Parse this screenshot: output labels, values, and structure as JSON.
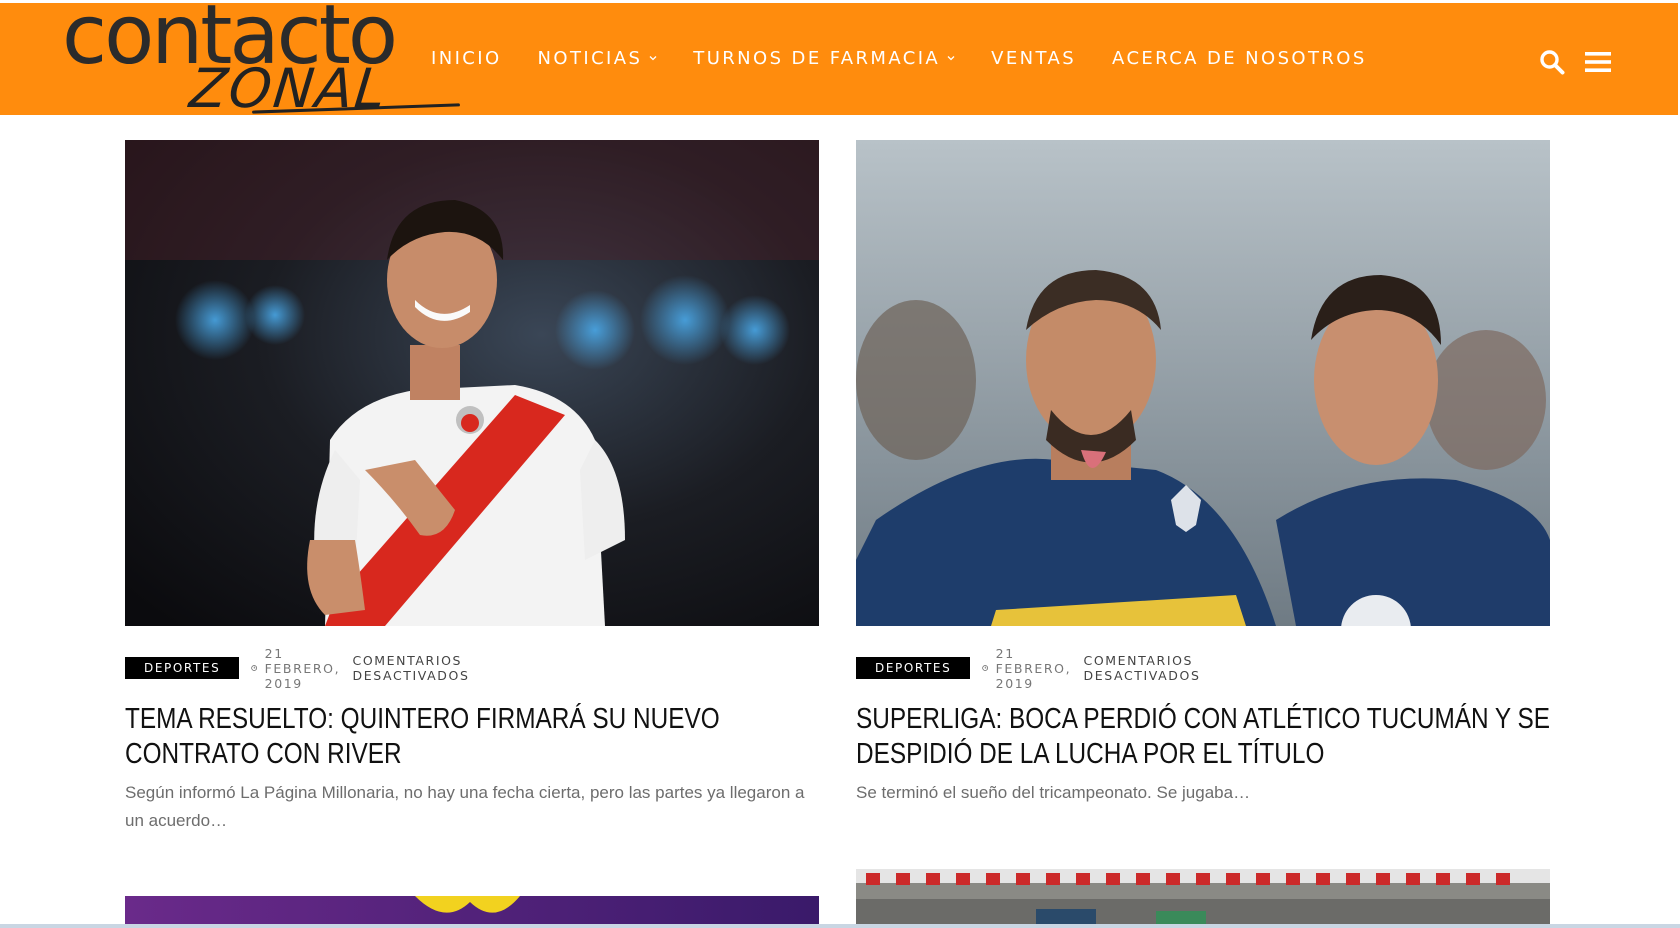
{
  "header": {
    "brand_color": "#ff8c0d",
    "logo_top": "contacto",
    "logo_bottom": "ZONAL",
    "nav": [
      {
        "label": "INICIO",
        "has_dropdown": false
      },
      {
        "label": "NOTICIAS",
        "has_dropdown": true
      },
      {
        "label": "TURNOS DE FARMACIA",
        "has_dropdown": true
      },
      {
        "label": "VENTAS",
        "has_dropdown": false
      },
      {
        "label": "ACERCA DE NOSOTROS",
        "has_dropdown": false
      }
    ],
    "icons": [
      "search-icon",
      "hamburger-menu-icon"
    ]
  },
  "posts": [
    {
      "category": "DEPORTES",
      "date": "21 FEBRERO, 2019",
      "comments": "COMENTARIOS DESACTIVADOS",
      "title": "TEMA RESUELTO: QUINTERO FIRMARÁ SU NUEVO CONTRATO CON RIVER",
      "excerpt": "Según informó La Página Millonaria, no hay una fecha cierta, pero las partes ya llegaron a un acuerdo…"
    },
    {
      "category": "DEPORTES",
      "date": "21 FEBRERO, 2019",
      "comments": "COMENTARIOS DESACTIVADOS",
      "title": "SUPERLIGA: BOCA PERDIÓ CON ATLÉTICO TUCUMÁN Y SE DESPIDIÓ DE LA LUCHA POR EL TÍTULO",
      "excerpt": "Se terminó el sueño del tricampeonato. Se jugaba…"
    }
  ]
}
